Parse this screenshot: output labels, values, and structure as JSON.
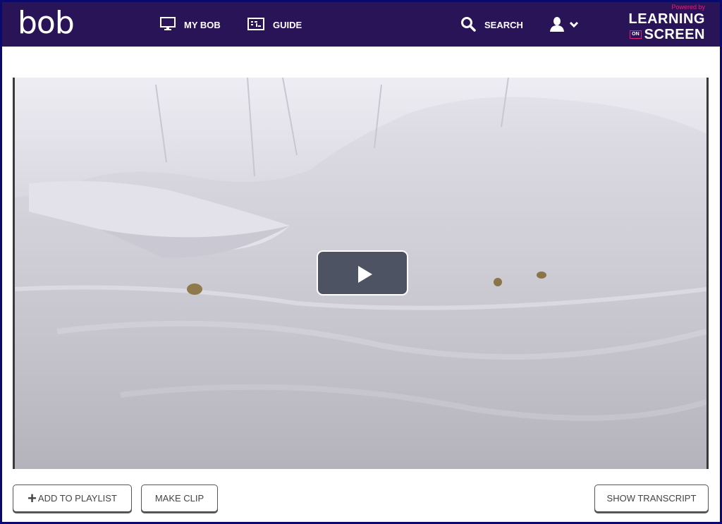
{
  "header": {
    "logo": "bob",
    "nav": [
      {
        "label": "MY BOB",
        "icon": "monitor-icon"
      },
      {
        "label": "GUIDE",
        "icon": "guide-icon"
      },
      {
        "label": "SEARCH",
        "icon": "search-icon"
      }
    ],
    "user_menu": {
      "icon": "user-icon",
      "chevron": "chevron-down-icon"
    },
    "brand": {
      "powered_by": "Powered by",
      "line1": "LEARNING",
      "on": "ON",
      "line2": "SCREEN",
      "accent_color": "#e0207e"
    }
  },
  "video": {
    "state": "paused",
    "play_icon": "play-icon"
  },
  "actions": {
    "add_to_playlist": "ADD TO PLAYLIST",
    "make_clip": "MAKE CLIP",
    "show_transcript": "SHOW TRANSCRIPT"
  },
  "colors": {
    "header_bg": "#2a1458",
    "outer_border": "#0a0a6e"
  }
}
